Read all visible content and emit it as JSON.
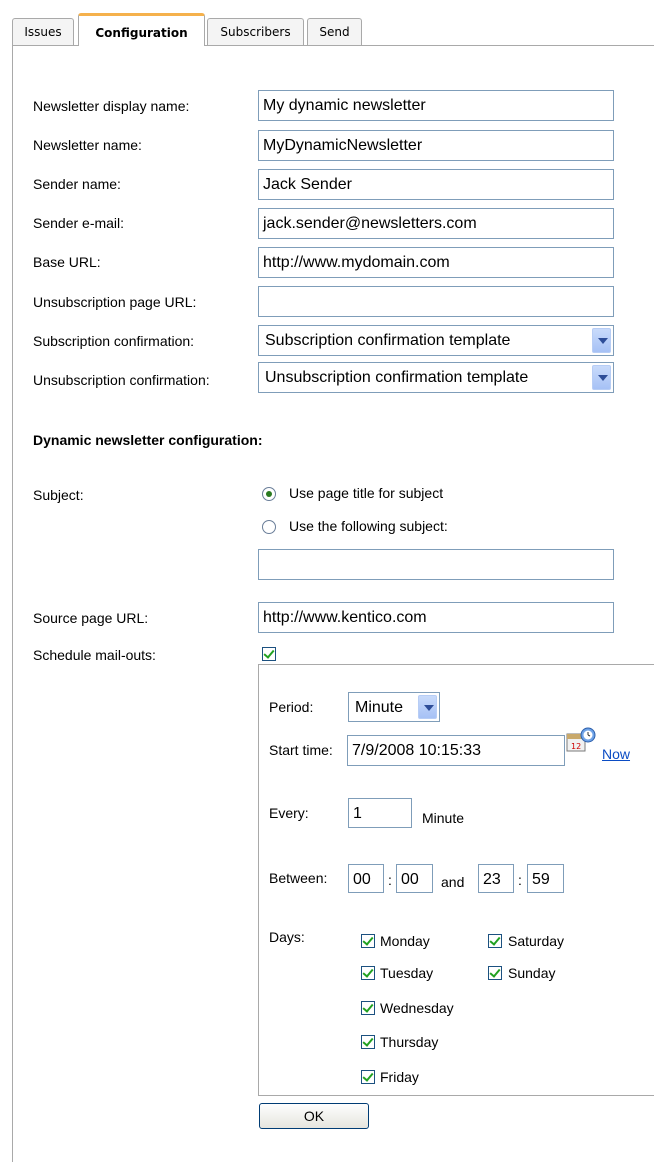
{
  "tabs": [
    {
      "label": "Issues"
    },
    {
      "label": "Configuration"
    },
    {
      "label": "Subscribers"
    },
    {
      "label": "Send"
    }
  ],
  "form": {
    "display_name_label": "Newsletter display name:",
    "display_name_value": "My dynamic newsletter",
    "name_label": "Newsletter name:",
    "name_value": "MyDynamicNewsletter",
    "sender_name_label": "Sender name:",
    "sender_name_value": "Jack Sender",
    "sender_email_label": "Sender e-mail:",
    "sender_email_value": "jack.sender@newsletters.com",
    "base_url_label": "Base URL:",
    "base_url_value": "http://www.mydomain.com",
    "unsub_page_label": "Unsubscription page URL:",
    "unsub_page_value": "",
    "sub_confirm_label": "Subscription confirmation:",
    "sub_confirm_value": "Subscription confirmation template",
    "unsub_confirm_label": "Unsubscription confirmation:",
    "unsub_confirm_value": "Unsubscription confirmation template"
  },
  "dynamic": {
    "heading": "Dynamic newsletter configuration:",
    "subject_label": "Subject:",
    "subject_option1": "Use page title for subject",
    "subject_option2": "Use the following subject:",
    "subject_value": "",
    "source_url_label": "Source page URL:",
    "source_url_value": "http://www.kentico.com",
    "schedule_label": "Schedule mail-outs:",
    "schedule_checked": true
  },
  "schedule": {
    "period_label": "Period:",
    "period_value": "Minute",
    "start_label": "Start time:",
    "start_value": "7/9/2008 10:15:33",
    "now_label": "Now",
    "every_label": "Every:",
    "every_value": "1",
    "every_unit": "Minute",
    "between_label": "Between:",
    "from_hour": "00",
    "from_min": "00",
    "and_label": "and",
    "to_hour": "23",
    "to_min": "59",
    "colon": ":",
    "days_label": "Days:",
    "days": [
      {
        "label": "Monday",
        "checked": true
      },
      {
        "label": "Tuesday",
        "checked": true
      },
      {
        "label": "Wednesday",
        "checked": true
      },
      {
        "label": "Thursday",
        "checked": true
      },
      {
        "label": "Friday",
        "checked": true
      },
      {
        "label": "Saturday",
        "checked": true
      },
      {
        "label": "Sunday",
        "checked": true
      }
    ]
  },
  "ok_label": "OK",
  "colors": {
    "tab_accent": "#f5b14c",
    "link": "#0b4cc4",
    "check": "#21a121",
    "border": "#7f9db9"
  }
}
